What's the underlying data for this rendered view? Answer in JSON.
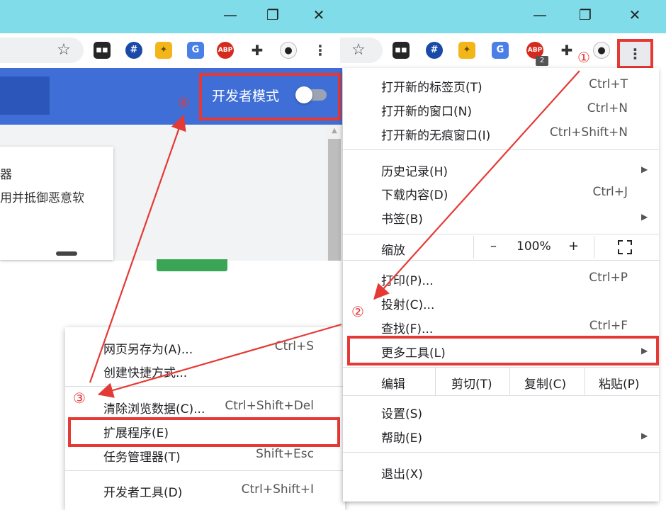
{
  "window_controls": {
    "minimize": "—",
    "restore": "❐",
    "close": "✕"
  },
  "extensions_page": {
    "dev_mode_label": "开发者模式",
    "card_title_fragment": "器",
    "card_desc_fragment": "用并抵御恶意软"
  },
  "more_tools_submenu": {
    "items": [
      {
        "label": "网页另存为(A)...",
        "shortcut": "Ctrl+S"
      },
      {
        "label": "创建快捷方式...",
        "shortcut": ""
      },
      {
        "label": "清除浏览数据(C)...",
        "shortcut": "Ctrl+Shift+Del"
      },
      {
        "label": "扩展程序(E)",
        "shortcut": ""
      },
      {
        "label": "任务管理器(T)",
        "shortcut": "Shift+Esc"
      },
      {
        "label": "开发者工具(D)",
        "shortcut": "Ctrl+Shift+I"
      }
    ]
  },
  "main_menu": {
    "new_tab": {
      "label": "打开新的标签页(T)",
      "shortcut": "Ctrl+T"
    },
    "new_window": {
      "label": "打开新的窗口(N)",
      "shortcut": "Ctrl+N"
    },
    "new_incognito": {
      "label": "打开新的无痕窗口(I)",
      "shortcut": "Ctrl+Shift+N"
    },
    "history": {
      "label": "历史记录(H)"
    },
    "downloads": {
      "label": "下载内容(D)",
      "shortcut": "Ctrl+J"
    },
    "bookmarks": {
      "label": "书签(B)"
    },
    "zoom": {
      "label": "缩放",
      "minus": "–",
      "value": "100%",
      "plus": "+"
    },
    "print": {
      "label": "打印(P)...",
      "shortcut": "Ctrl+P"
    },
    "cast": {
      "label": "投射(C)..."
    },
    "find": {
      "label": "查找(F)...",
      "shortcut": "Ctrl+F"
    },
    "more_tools": {
      "label": "更多工具(L)"
    },
    "edit": {
      "label": "编辑",
      "cut": "剪切(T)",
      "copy": "复制(C)",
      "paste": "粘贴(P)"
    },
    "settings": {
      "label": "设置(S)"
    },
    "help": {
      "label": "帮助(E)"
    },
    "exit": {
      "label": "退出(X)"
    }
  },
  "toolbar_icons": [
    "star-icon",
    "extension-dark-icon",
    "hash-icon",
    "fox-icon",
    "translate-icon",
    "adblock-icon",
    "puzzle-icon",
    "panda-avatar-icon",
    "kebab-menu-icon"
  ],
  "abp_badge": "2",
  "annotations": {
    "step1": "①",
    "step2": "②",
    "step3": "③",
    "step4": "④"
  },
  "colors": {
    "highlight": "#e53935",
    "titlebar": "#7fdce8",
    "ext_header": "#3f6fd6"
  }
}
